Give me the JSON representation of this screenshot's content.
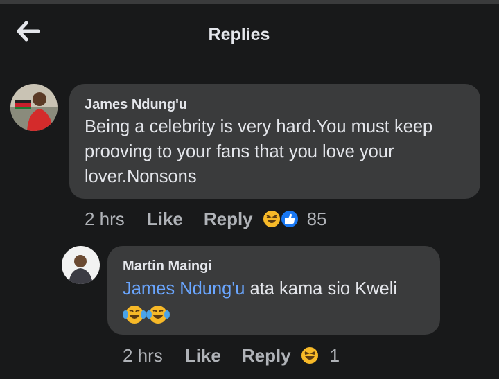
{
  "header": {
    "title": "Replies",
    "back_icon": "arrow-left-icon"
  },
  "comments": [
    {
      "author": "James Ndung'u",
      "text": "Being a celebrity is very hard.You must keep prooving to your fans that you love your lover.Nonsons",
      "time": "2 hrs",
      "like_label": "Like",
      "reply_label": "Reply",
      "reactions": [
        "laughing-emoji-icon",
        "thumbs-up-icon"
      ],
      "reaction_count": "85"
    },
    {
      "author": "Martin Maingi",
      "mention": "James Ndung'u",
      "text": " ata kama sio Kweli",
      "emojis": [
        "tears-of-joy-emoji-icon",
        "tears-of-joy-emoji-icon"
      ],
      "time": "2 hrs",
      "like_label": "Like",
      "reply_label": "Reply",
      "reactions": [
        "laughing-emoji-icon"
      ],
      "reaction_count": "1"
    }
  ],
  "colors": {
    "background": "#18191a",
    "bubble": "#3a3b3c",
    "mention": "#6aa6ff",
    "like_reaction": "#1877f2",
    "emoji_yellow": "#f7b928"
  }
}
